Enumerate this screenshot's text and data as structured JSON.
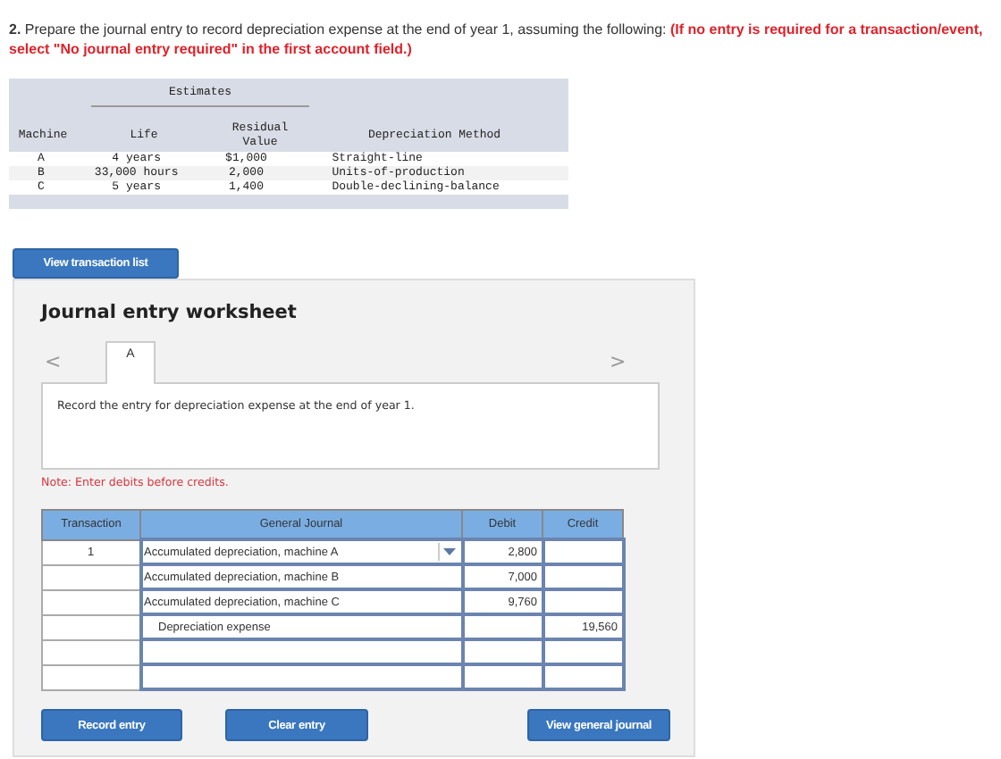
{
  "question": {
    "number": "2.",
    "text": "Prepare the journal entry to record depreciation expense at the end of year 1, assuming the following:",
    "instruction": "(If no entry is required for a transaction/event, select \"No journal entry required\" in the first account field.)"
  },
  "estimates_table": {
    "group_heading": "Estimates",
    "columns": [
      "Machine",
      "Life",
      "Residual Value",
      "Depreciation Method"
    ],
    "rows": [
      [
        "A",
        "4 years",
        "$1,000",
        "Straight-line"
      ],
      [
        "B",
        "33,000 hours",
        "2,000",
        "Units-of-production"
      ],
      [
        "C",
        "5 years",
        "1,400",
        "Double-declining-balance"
      ]
    ]
  },
  "view_transaction_button": "View transaction list",
  "worksheet": {
    "title": "Journal entry worksheet",
    "prev_icon": "<",
    "next_icon": ">",
    "tabs": [
      {
        "label": "A",
        "selected": true
      }
    ],
    "instruction": "Record the entry for depreciation expense at the end of year 1.",
    "note": "Note: Enter debits before credits.",
    "journal": {
      "columns": [
        "Transaction",
        "General Journal",
        "Debit",
        "Credit"
      ],
      "rows": [
        {
          "transaction": "1",
          "account": "Accumulated depreciation, machine A",
          "debit": "2,800",
          "dropdown": true,
          "indented": false
        },
        {
          "account": "Accumulated depreciation, machine B",
          "debit": "7,000",
          "dropdown": false,
          "indented": false
        },
        {
          "account": "Accumulated depreciation, machine C",
          "debit": "9,760",
          "dropdown": false,
          "indented": false
        },
        {
          "account": "Depreciation expense",
          "credit": "19,560",
          "dropdown": false,
          "indented": true
        },
        {
          "dropdown": false
        },
        {
          "dropdown": false
        }
      ]
    },
    "buttons": [
      "Record entry",
      "Clear entry",
      "View general journal"
    ]
  }
}
